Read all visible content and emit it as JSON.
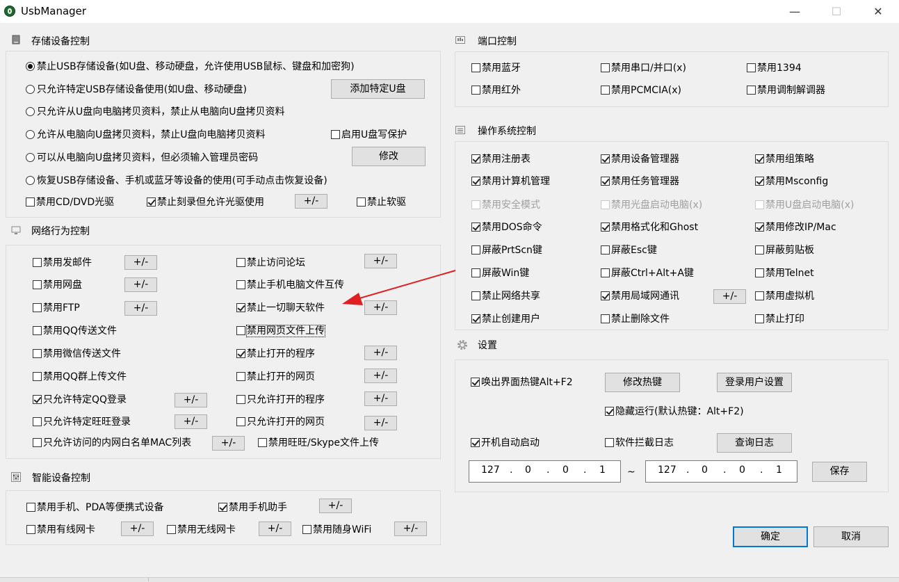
{
  "window": {
    "title": "UsbManager",
    "minimize": "—",
    "maximize": "☐",
    "close": "✕"
  },
  "storage": {
    "title": "存储设备控制",
    "radios": [
      "禁止USB存储设备(如U盘、移动硬盘，允许使用USB鼠标、键盘和加密狗)",
      "只允许特定USB存储设备使用(如U盘、移动硬盘)",
      "只允许从U盘向电脑拷贝资料，禁止从电脑向U盘拷贝资料",
      "允许从电脑向U盘拷贝资料，禁止U盘向电脑拷贝资料",
      "可以从电脑向U盘拷贝资料，但必须输入管理员密码",
      "恢复USB存储设备、手机或蓝牙等设备的使用(可手动点击恢复设备)"
    ],
    "selected_index": 0,
    "add_usb_button": "添加特定U盘",
    "enable_write_protect": "启用U盘写保护",
    "modify_button": "修改",
    "disable_cd": "禁用CD/DVD光驱",
    "forbid_burn": "禁止刻录但允许光驱使用",
    "pm": "+/-",
    "forbid_floppy": "禁止软驱"
  },
  "network": {
    "title": "网络行为控制",
    "items": [
      "禁用发邮件",
      "禁用网盘",
      "禁用FTP",
      "禁用QQ传送文件",
      "禁用微信传送文件",
      "禁用QQ群上传文件",
      "只允许特定QQ登录",
      "只允许特定旺旺登录",
      "只允许访问的内网白名单MAC列表",
      "禁止访问论坛",
      "禁止手机电脑文件互传",
      "禁止一切聊天软件",
      "禁用网页文件上传",
      "禁止打开的程序",
      "禁止打开的网页",
      "只允许打开的程序",
      "只允许打开的网页",
      "禁用旺旺/Skype文件上传"
    ]
  },
  "smart": {
    "title": "智能设备控制",
    "items": [
      "禁用手机、PDA等便携式设备",
      "禁用手机助手",
      "禁用有线网卡",
      "禁用无线网卡",
      "禁用随身WiFi"
    ]
  },
  "port": {
    "title": "端口控制",
    "items": [
      "禁用蓝牙",
      "禁用串口/并口(x)",
      "禁用1394",
      "禁用红外",
      "禁用PCMCIA(x)",
      "禁用调制解调器"
    ]
  },
  "os": {
    "title": "操作系统控制",
    "items": [
      "禁用注册表",
      "禁用设备管理器",
      "禁用组策略",
      "禁用计算机管理",
      "禁用任务管理器",
      "禁用Msconfig",
      "禁用安全模式",
      "禁用光盘启动电脑(x)",
      "禁用U盘启动电脑(x)",
      "禁用DOS命令",
      "禁用格式化和Ghost",
      "禁用修改IP/Mac",
      "屏蔽PrtScn键",
      "屏蔽Esc键",
      "屏蔽剪贴板",
      "屏蔽Win键",
      "屏蔽Ctrl+Alt+A键",
      "禁用Telnet",
      "禁止网络共享",
      "禁用局域网通讯",
      "禁用虚拟机",
      "禁止创建用户",
      "禁止删除文件",
      "禁止打印"
    ]
  },
  "settings": {
    "title": "设置",
    "hotkey_label": "唤出界面热键Alt+F2",
    "modify_hotkey": "修改热键",
    "login_settings": "登录用户设置",
    "hidden_run": "隐藏运行(默认热键：Alt+F2)",
    "autostart": "开机自动启动",
    "intercept_log": "软件拦截日志",
    "query_log": "查询日志",
    "ip_from": [
      "127",
      "0",
      "0",
      "1"
    ],
    "ip_to": [
      "127",
      "0",
      "0",
      "1"
    ],
    "dot": ".",
    "tilde": "~",
    "save": "保存"
  },
  "footer": {
    "ok": "确定",
    "cancel": "取消"
  },
  "colors": {
    "arrow": "#e02020",
    "default_border": "#0078d7"
  }
}
